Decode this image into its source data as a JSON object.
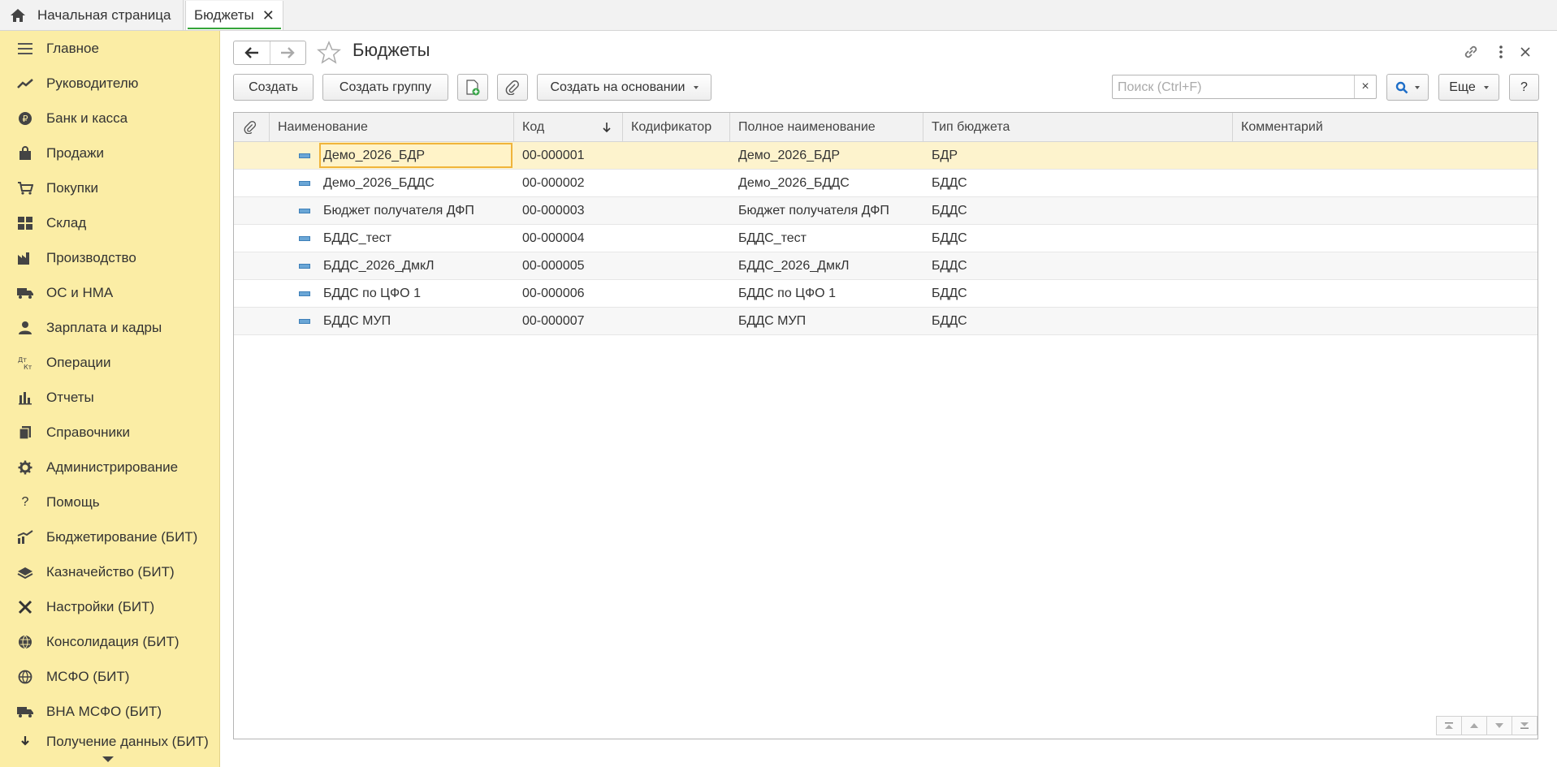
{
  "tabs": {
    "home_label": "Начальная страница",
    "active_label": "Бюджеты",
    "close_glyph": "✕"
  },
  "sidebar": {
    "items": [
      {
        "label": "Главное",
        "icon": "menu-lines-icon"
      },
      {
        "label": "Руководителю",
        "icon": "trend-icon"
      },
      {
        "label": "Банк и касса",
        "icon": "ruble-coin-icon"
      },
      {
        "label": "Продажи",
        "icon": "shopping-bag-icon"
      },
      {
        "label": "Покупки",
        "icon": "shopping-cart-icon"
      },
      {
        "label": "Склад",
        "icon": "warehouse-icon"
      },
      {
        "label": "Производство",
        "icon": "factory-icon"
      },
      {
        "label": "ОС и НМА",
        "icon": "truck-icon"
      },
      {
        "label": "Зарплата и кадры",
        "icon": "person-icon"
      },
      {
        "label": "Операции",
        "icon": "dt-kt-icon"
      },
      {
        "label": "Отчеты",
        "icon": "bar-chart-icon"
      },
      {
        "label": "Справочники",
        "icon": "books-icon"
      },
      {
        "label": "Администрирование",
        "icon": "gear-icon"
      },
      {
        "label": "Помощь",
        "icon": "question-icon"
      },
      {
        "label": "Бюджетирование (БИТ)",
        "icon": "trend-chart-icon"
      },
      {
        "label": "Казначейство (БИТ)",
        "icon": "money-stack-icon"
      },
      {
        "label": "Настройки (БИТ)",
        "icon": "tools-icon"
      },
      {
        "label": "Консолидация (БИТ)",
        "icon": "globe-network-icon"
      },
      {
        "label": "МСФО (БИТ)",
        "icon": "globe-icon"
      },
      {
        "label": "ВНА МСФО (БИТ)",
        "icon": "truck-icon"
      },
      {
        "label": "Получение данных (БИТ)",
        "icon": "download-icon"
      }
    ]
  },
  "header": {
    "title": "Бюджеты"
  },
  "toolbar": {
    "create": "Создать",
    "create_group": "Создать группу",
    "create_based_on": "Создать на основании",
    "search_placeholder": "Поиск (Ctrl+F)",
    "clear": "×",
    "more": "Еще",
    "help": "?"
  },
  "table": {
    "columns": [
      "Наименование",
      "Код",
      "Кодификатор",
      "Полное наименование",
      "Тип бюджета",
      "Комментарий"
    ],
    "rows": [
      {
        "name": "Демо_2026_БДР",
        "code": "00-000001",
        "codifier": "",
        "full_name": "Демо_2026_БДР",
        "type": "БДР",
        "comment": ""
      },
      {
        "name": "Демо_2026_БДДС",
        "code": "00-000002",
        "codifier": "",
        "full_name": "Демо_2026_БДДС",
        "type": "БДДС",
        "comment": ""
      },
      {
        "name": "Бюджет получателя ДФП",
        "code": "00-000003",
        "codifier": "",
        "full_name": "Бюджет получателя ДФП",
        "type": "БДДС",
        "comment": ""
      },
      {
        "name": "БДДС_тест",
        "code": "00-000004",
        "codifier": "",
        "full_name": "БДДС_тест",
        "type": "БДДС",
        "comment": ""
      },
      {
        "name": "БДДС_2026_ДмкЛ",
        "code": "00-000005",
        "codifier": "",
        "full_name": "БДДС_2026_ДмкЛ",
        "type": "БДДС",
        "comment": ""
      },
      {
        "name": "БДДС по ЦФО 1",
        "code": "00-000006",
        "codifier": "",
        "full_name": "БДДС по ЦФО 1",
        "type": "БДДС",
        "comment": ""
      },
      {
        "name": "БДДС МУП",
        "code": "00-000007",
        "codifier": "",
        "full_name": "БДДС МУП",
        "type": "БДДС",
        "comment": ""
      }
    ],
    "selected_row": 0
  },
  "colors": {
    "sidebar_bg": "#fbeda5",
    "selection_bg": "#fdf3cd",
    "selection_border": "#f0b43a",
    "tab_accent": "#35a53a",
    "search_accent": "#1e6ec8"
  }
}
